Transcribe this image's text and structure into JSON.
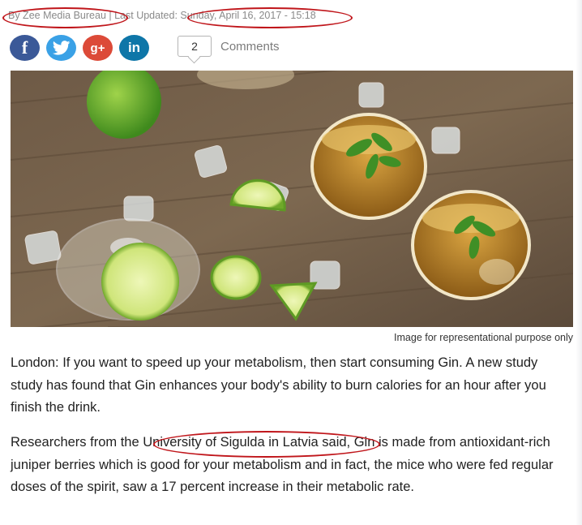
{
  "byline": {
    "author": "By Zee Media Bureau",
    "updated_label": " | Last Updated: ",
    "date": "Sunday, April 16, 2017 - 15:18"
  },
  "social": {
    "facebook_glyph": "f",
    "googleplus_glyph": "g+",
    "linkedin_glyph": "in"
  },
  "comments": {
    "count": "2",
    "label": "Comments"
  },
  "article": {
    "image_caption": "Image for representational purpose only",
    "p1": "London: If you want to speed up your metabolism, then start consuming Gin. A new study study has found that Gin enhances your body's ability to burn calories for an hour after you finish the drink.",
    "p2_before": "Researchers from the ",
    "p2_highlight": "University of Sigulda in Latvia",
    "p2_after": " said, Gin is made from antioxidant-rich juniper berries which is good for your metabolism and in fact, the mice who were fed regular doses of the spirit, saw a 17 percent increase in their metabolic rate."
  },
  "colors": {
    "annotation": "#c0161b",
    "facebook": "#3b5998",
    "twitter": "#3aa1e6",
    "googleplus": "#dc4a38",
    "linkedin": "#0e76a8"
  }
}
